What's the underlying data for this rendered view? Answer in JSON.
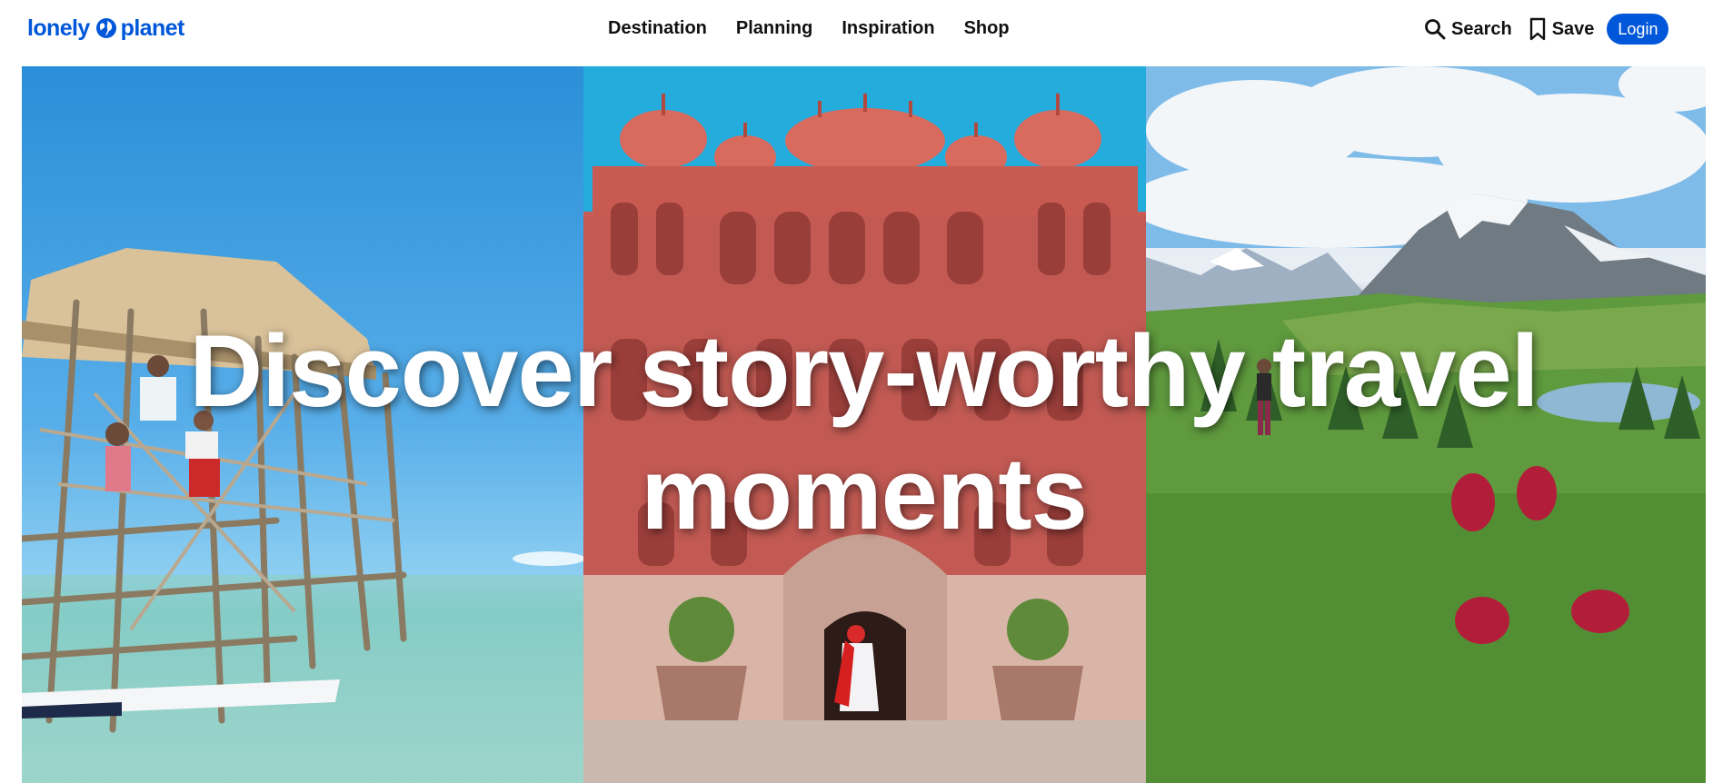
{
  "header": {
    "logo_text_left": "lonely",
    "logo_text_right": "planet",
    "nav": [
      {
        "label": "Destination"
      },
      {
        "label": "Planning"
      },
      {
        "label": "Inspiration"
      },
      {
        "label": "Shop"
      }
    ],
    "search_label": "Search",
    "save_label": "Save",
    "login_label": "Login"
  },
  "hero": {
    "headline_line1": "Discover story-worthy travel",
    "headline_line2": "moments"
  },
  "colors": {
    "brand_blue": "#0057d9",
    "text": "#111111",
    "headline": "#ffffff"
  },
  "icons": {
    "search": "search-icon",
    "save": "bookmark-icon",
    "logo": "globe-icon"
  }
}
